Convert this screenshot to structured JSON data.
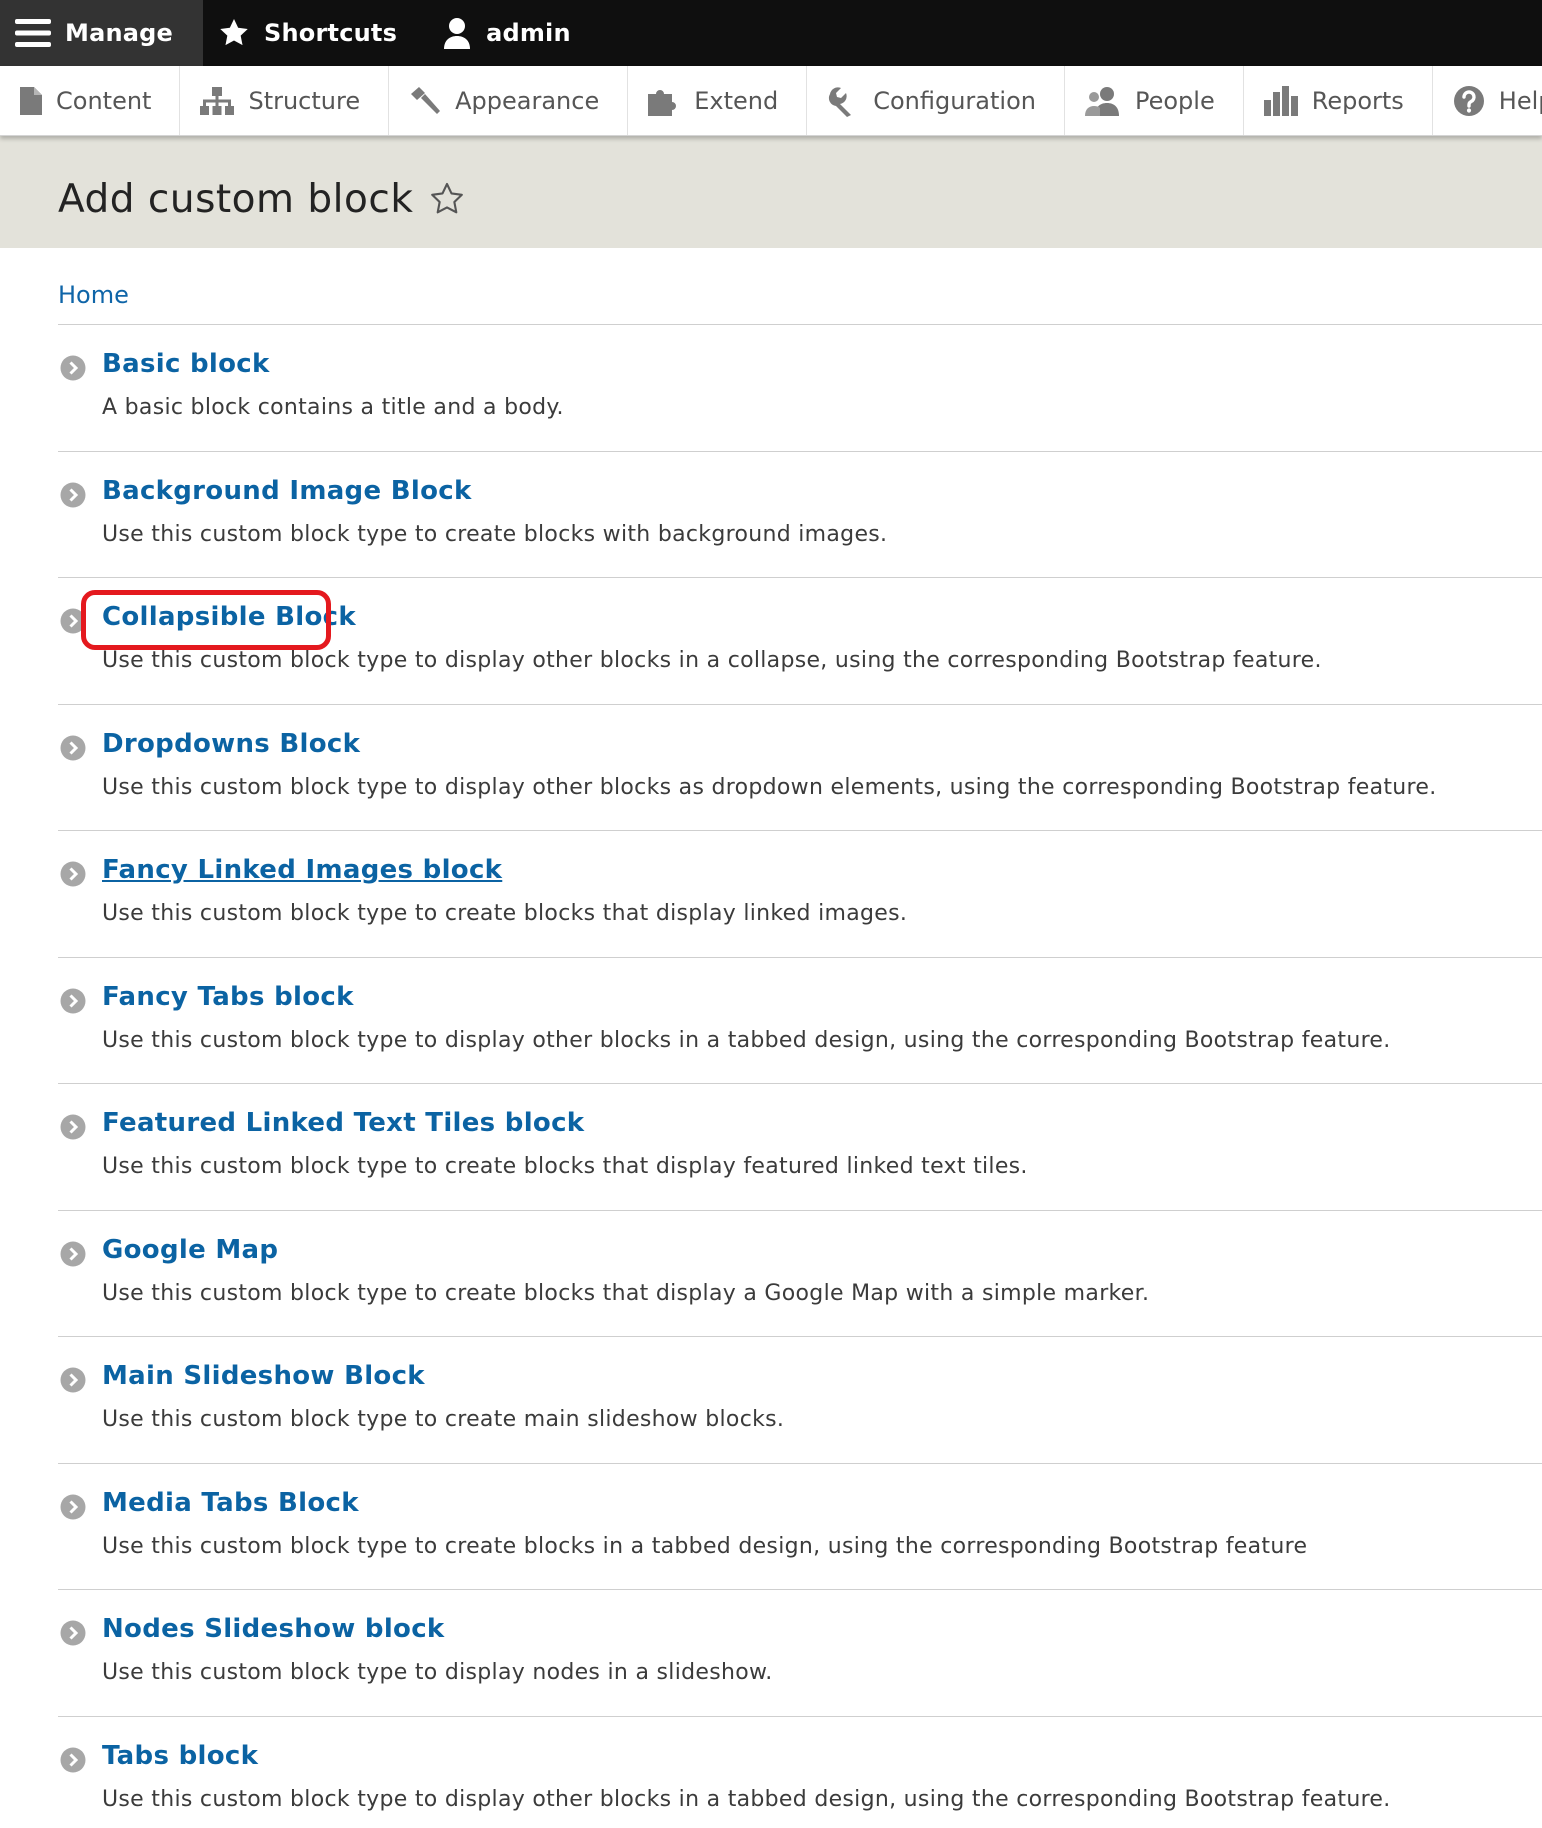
{
  "toolbar": {
    "manage_label": "Manage",
    "shortcuts_label": "Shortcuts",
    "user_label": "admin"
  },
  "tray": {
    "items": [
      {
        "label": "Content",
        "icon": "document-icon"
      },
      {
        "label": "Structure",
        "icon": "sitemap-icon"
      },
      {
        "label": "Appearance",
        "icon": "paintbrush-icon"
      },
      {
        "label": "Extend",
        "icon": "puzzle-icon"
      },
      {
        "label": "Configuration",
        "icon": "wrench-icon"
      },
      {
        "label": "People",
        "icon": "people-icon"
      },
      {
        "label": "Reports",
        "icon": "bar-chart-icon"
      },
      {
        "label": "Help",
        "icon": "help-icon"
      }
    ]
  },
  "page": {
    "title": "Add custom block"
  },
  "breadcrumb": {
    "home_label": "Home"
  },
  "blocks": [
    {
      "title": "Basic block",
      "description": "A basic block contains a title and a body."
    },
    {
      "title": "Background Image Block",
      "description": "Use this custom block type to create blocks with background images."
    },
    {
      "title": "Collapsible Block",
      "description": "Use this custom block type to display other blocks in a collapse, using the corresponding Bootstrap feature."
    },
    {
      "title": "Dropdowns Block",
      "description": "Use this custom block type to display other blocks as dropdown elements, using the corresponding Bootstrap feature."
    },
    {
      "title": "Fancy Linked Images block",
      "description": "Use this custom block type to create blocks that display linked images."
    },
    {
      "title": "Fancy Tabs block",
      "description": "Use this custom block type to display other blocks in a tabbed design, using the corresponding Bootstrap feature."
    },
    {
      "title": "Featured Linked Text Tiles block",
      "description": "Use this custom block type to create blocks that display featured linked text tiles."
    },
    {
      "title": "Google Map",
      "description": "Use this custom block type to create blocks that display a Google Map with a simple marker."
    },
    {
      "title": "Main Slideshow Block",
      "description": "Use this custom block type to create main slideshow blocks."
    },
    {
      "title": "Media Tabs Block",
      "description": "Use this custom block type to create blocks in a tabbed design, using the corresponding Bootstrap feature"
    },
    {
      "title": "Nodes Slideshow block",
      "description": "Use this custom block type to display nodes in a slideshow."
    },
    {
      "title": "Tabs block",
      "description": "Use this custom block type to display other blocks in a tabbed design, using the corresponding Bootstrap feature."
    }
  ],
  "colors": {
    "toolbar_bg": "#0f0f0f",
    "header_bg": "#e3e2da",
    "link": "#0b63a3",
    "highlight": "#e4191e"
  }
}
